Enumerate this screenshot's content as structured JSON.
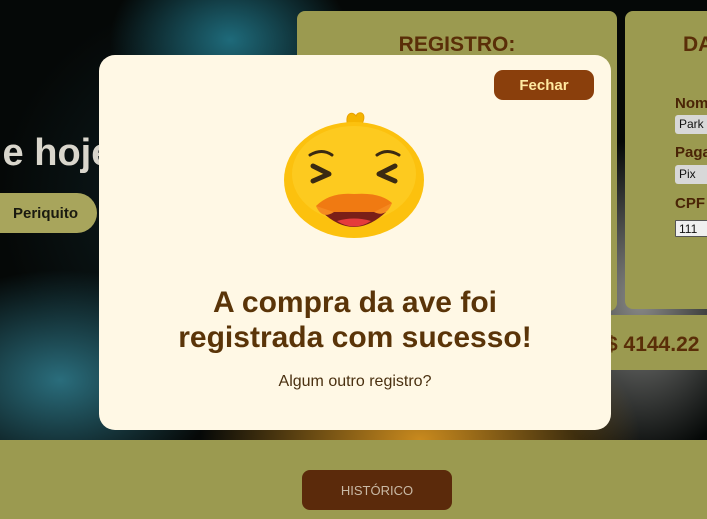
{
  "hero": {
    "heading": "le hoje",
    "bird_button": "Periquito"
  },
  "registro": {
    "title": "REGISTRO:"
  },
  "dados": {
    "title": "DADOS",
    "name_label": "Nome",
    "name_value": "Park",
    "payment_label": "Pagamento",
    "payment_value": "Pix",
    "cpf_label": "CPF",
    "cpf_value": "111"
  },
  "total": {
    "text": "$ 4144.22"
  },
  "footer": {
    "history_button": "HISTÓRICO"
  },
  "modal": {
    "close_label": "Fechar",
    "title_line1": "A compra da ave foi",
    "title_line2": "registrada com sucesso!",
    "subtitle": "Algum outro registro?",
    "icon": "happy-duck-icon"
  },
  "colors": {
    "olive": "#9b9a50",
    "brown": "#5a2e08",
    "modal_bg": "#fff8e5",
    "close_btn": "#8a3f0c",
    "history_btn": "#5b2a0b"
  }
}
